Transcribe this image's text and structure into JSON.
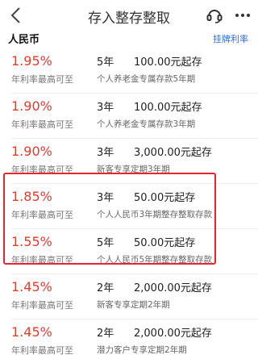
{
  "header": {
    "title": "存入整存整取"
  },
  "section": {
    "title": "人民币",
    "link": "挂牌利率"
  },
  "products": [
    {
      "rate": "1.95%",
      "rate_label": "年利率最高可至",
      "term": "5年",
      "amount": "100.00元起存",
      "desc": "个人养老金专属存款5年期"
    },
    {
      "rate": "1.90%",
      "rate_label": "年利率最高可至",
      "term": "3年",
      "amount": "100.00元起存",
      "desc": "个人养老金专属存款3年期"
    },
    {
      "rate": "1.90%",
      "rate_label": "年利率最高可至",
      "term": "3年",
      "amount": "3,000.00元起存",
      "desc": "新客专享定期3年期"
    },
    {
      "rate": "1.85%",
      "rate_label": "年利率最高可至",
      "term": "3年",
      "amount": "50.00元起存",
      "desc": "个人人民币3年期整存整取存款"
    },
    {
      "rate": "1.55%",
      "rate_label": "年利率最高可至",
      "term": "5年",
      "amount": "50.00元起存",
      "desc": "个人人民币5年期整存整取存款"
    },
    {
      "rate": "1.45%",
      "rate_label": "年利率最高可至",
      "term": "2年",
      "amount": "2,000.00元起存",
      "desc": "新客专享定期2年期"
    },
    {
      "rate": "1.45%",
      "rate_label": "年利率最高可至",
      "term": "2年",
      "amount": "2,000.00元起存",
      "desc": "潜力客户专享定期2年期"
    }
  ],
  "colors": {
    "rate": "#e03b2c",
    "highlight": "#e5262e",
    "link": "#2f6fd6"
  },
  "icons": [
    "back-arrow-icon",
    "headset-icon",
    "more-dots-icon"
  ]
}
